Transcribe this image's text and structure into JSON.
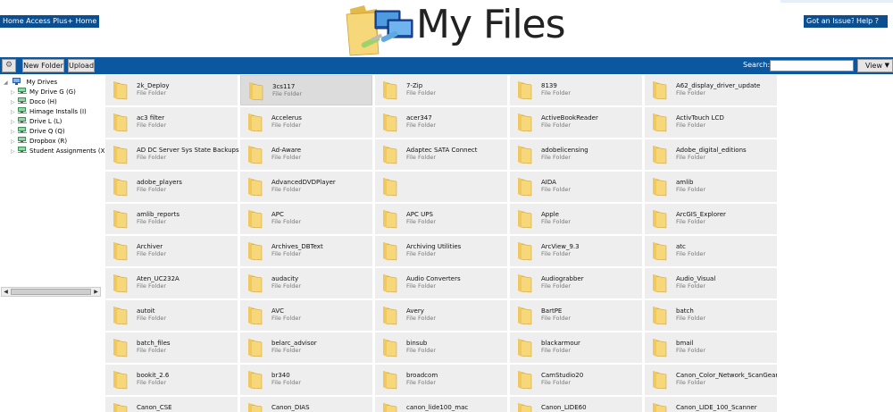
{
  "header": {
    "home_link": "Home Access Plus+ Home",
    "title": "My Files",
    "issue_button": "Got an Issue?",
    "help_button": "Help ?"
  },
  "toolbar": {
    "new_folder": "New Folder",
    "upload": "Upload",
    "search_label": "Search:",
    "search_value": "",
    "view_label": "View"
  },
  "tree": {
    "root": "My Drives",
    "items": [
      "My Drive G (G)",
      "Doco (H)",
      "Himage Installs (I)",
      "Drive L (L)",
      "Drive Q (Q)",
      "Dropbox (R)",
      "Student Assignments (X)"
    ]
  },
  "folder_type": "File Folder",
  "files": [
    "2k_Deploy",
    "3cs117",
    "7-Zip",
    "8139",
    "A62_display_driver_update",
    "ac3 filter",
    "Accelerus",
    "acer347",
    "ActiveBookReader",
    "ActivTouch LCD",
    "AD DC Server Sys State Backups",
    "Ad-Aware",
    "Adaptec SATA Connect",
    "adobelicensing",
    "Adobe_digital_editions",
    "adobe_players",
    "AdvancedDVDPlayer",
    "",
    "AIDA",
    "amlib",
    "amlib_reports",
    "APC",
    "APC UPS",
    "Apple",
    "ArcGIS_Explorer",
    "Archiver",
    "Archives_DBText",
    "Archiving Utilities",
    "ArcView_9.3",
    "atc",
    "Aten_UC232A",
    "audacity",
    "Audio Converters",
    "Audiograbber",
    "Audio_Visual",
    "autoit",
    "AVC",
    "Avery",
    "BartPE",
    "batch",
    "batch_files",
    "belarc_advisor",
    "binsub",
    "blackarmour",
    "bmail",
    "bookit_2.6",
    "br340",
    "broadcom",
    "CamStudio20",
    "Canon_Color_Network_ScanGear",
    "Canon_CSE",
    "Canon_DIAS",
    "canon_lide100_mac",
    "Canon_LIDE60",
    "Canon_LIDE_100_Scanner"
  ],
  "selected_index": 1,
  "colors": {
    "toolbar": "#0b58a0",
    "header_button": "#0b4f91",
    "tile": "#eeeeee",
    "folder_front": "#f6d77a",
    "folder_back": "#e3b94c"
  }
}
